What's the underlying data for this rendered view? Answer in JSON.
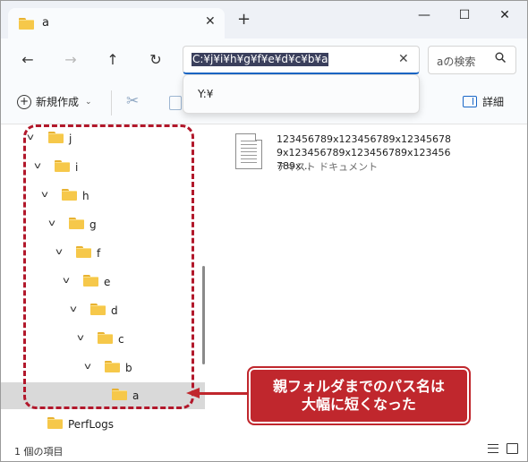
{
  "tab": {
    "title": "a",
    "close": "✕",
    "new_tab": "+"
  },
  "window_controls": {
    "minimize": "—",
    "maximize": "☐",
    "close": "✕"
  },
  "nav": {
    "back": "←",
    "forward": "→",
    "up": "↑",
    "refresh": "↻"
  },
  "address": {
    "value": "C:¥j¥i¥h¥g¥f¥e¥d¥c¥b¥a",
    "clear": "✕"
  },
  "search": {
    "placeholder": "aの検索",
    "icon": "search-icon"
  },
  "command_bar": {
    "new_label": "新規作成",
    "details_label": "詳細"
  },
  "address_dropdown": {
    "items": [
      "Y:¥"
    ]
  },
  "tree": [
    {
      "label": "j",
      "expanded": true
    },
    {
      "label": "i",
      "expanded": true
    },
    {
      "label": "h",
      "expanded": true
    },
    {
      "label": "g",
      "expanded": true
    },
    {
      "label": "f",
      "expanded": true
    },
    {
      "label": "e",
      "expanded": true
    },
    {
      "label": "d",
      "expanded": true
    },
    {
      "label": "c",
      "expanded": true
    },
    {
      "label": "b",
      "expanded": true
    },
    {
      "label": "a",
      "selected": true
    },
    {
      "label": "PerfLogs"
    }
  ],
  "files": [
    {
      "name": "123456789x123456789x123456789x123456789x123456789x123456789x...",
      "type": "テキスト ドキュメント"
    }
  ],
  "status": {
    "item_count": "1 個の項目"
  },
  "annotation": {
    "line1": "親フォルダまでのパス名は",
    "line2": "大幅に短くなった",
    "color": "#c0272d"
  }
}
